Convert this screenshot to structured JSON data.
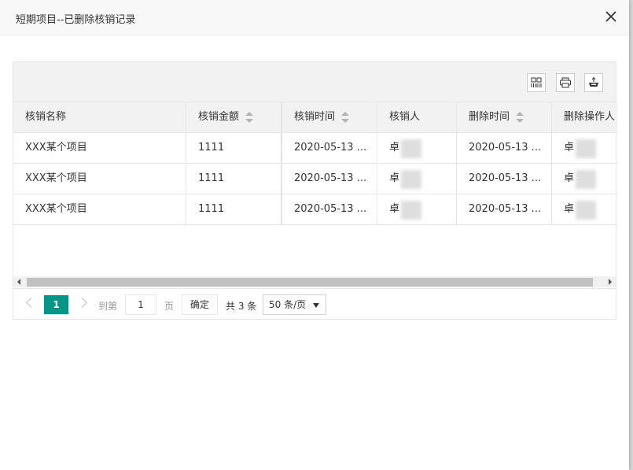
{
  "dialog": {
    "title": "短期项目--已删除核销记录"
  },
  "table": {
    "columns": [
      "核销名称",
      "核销金额",
      "核销时间",
      "核销人",
      "删除时间",
      "删除操作人"
    ],
    "rows": [
      [
        "XXX某个项目",
        "1111",
        "2020-05-13 ...",
        "卓",
        "2020-05-13 ...",
        "卓"
      ],
      [
        "XXX某个项目",
        "1111",
        "2020-05-13 ...",
        "卓",
        "2020-05-13 ...",
        "卓"
      ],
      [
        "XXX某个项目",
        "1111",
        "2020-05-13 ...",
        "卓",
        "2020-05-13 ...",
        "卓"
      ]
    ]
  },
  "pager": {
    "current_page": "1",
    "goto_label": "到第",
    "goto_value": "1",
    "page_unit": "页",
    "confirm_label": "确定",
    "total_label": "共 3 条",
    "page_size": "50 条/页"
  },
  "colors": {
    "accent": "#009688",
    "header_bg": "#f2f2f2"
  }
}
